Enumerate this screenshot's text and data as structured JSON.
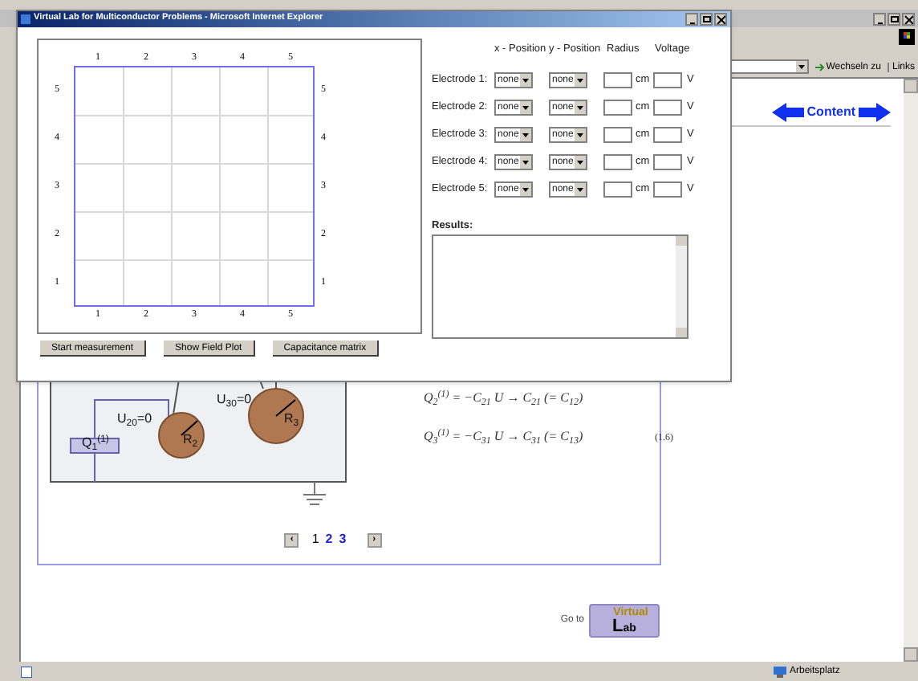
{
  "browser": {
    "go_button": "Wechseln zu",
    "links": "Links"
  },
  "page": {
    "nav_label": "Content",
    "diagram": {
      "labels": [
        "U$_{20}$=0",
        "U$_{30}$=0",
        "R$_{2}$",
        "R$_{3}$",
        "Q$_{1}$$^{(1)}$"
      ]
    },
    "equations": [
      "Q$_{2}$$^{(1)}$ = −C$_{21}$ U → C$_{21}$ (= C$_{12}$)",
      "Q$_{3}$$^{(1)}$ = −C$_{31}$ U → C$_{31}$ (= C$_{13}$)"
    ],
    "equation_number": "(1.6)",
    "pagination": {
      "prev": "‹",
      "next": "›",
      "pages": [
        {
          "label": "1",
          "selected": true
        },
        {
          "label": "2",
          "selected": false
        },
        {
          "label": "3",
          "selected": false
        }
      ]
    },
    "goto_label": "Go to",
    "virtual_lab": {
      "top": "Virtual",
      "bottom": "Lab"
    }
  },
  "status_bar": {
    "zone": "Arbeitsplatz"
  },
  "popup": {
    "title": "Virtual Lab for Multiconductor Problems - Microsoft Internet Explorer",
    "grid": {
      "top_ticks": [
        "1",
        "2",
        "3",
        "4",
        "5"
      ],
      "bottom_ticks": [
        "1",
        "2",
        "3",
        "4",
        "5"
      ],
      "left_ticks": [
        "5",
        "4",
        "3",
        "2",
        "1"
      ],
      "right_ticks": [
        "5",
        "4",
        "3",
        "2",
        "1"
      ]
    },
    "buttons": [
      "Start measurement",
      "Show Field Plot",
      "Capacitance matrix"
    ],
    "columns": [
      "x - Position",
      "y - Position",
      "Radius",
      "Voltage"
    ],
    "electrodes": [
      {
        "label": "Electrode 1:",
        "x": "none",
        "y": "none",
        "radius_unit": "cm",
        "voltage_unit": "V"
      },
      {
        "label": "Electrode 2:",
        "x": "none",
        "y": "none",
        "radius_unit": "cm",
        "voltage_unit": "V"
      },
      {
        "label": "Electrode 3:",
        "x": "none",
        "y": "none",
        "radius_unit": "cm",
        "voltage_unit": "V"
      },
      {
        "label": "Electrode 4:",
        "x": "none",
        "y": "none",
        "radius_unit": "cm",
        "voltage_unit": "V"
      },
      {
        "label": "Electrode 5:",
        "x": "none",
        "y": "none",
        "radius_unit": "cm",
        "voltage_unit": "V"
      }
    ],
    "results_label": "Results:"
  }
}
